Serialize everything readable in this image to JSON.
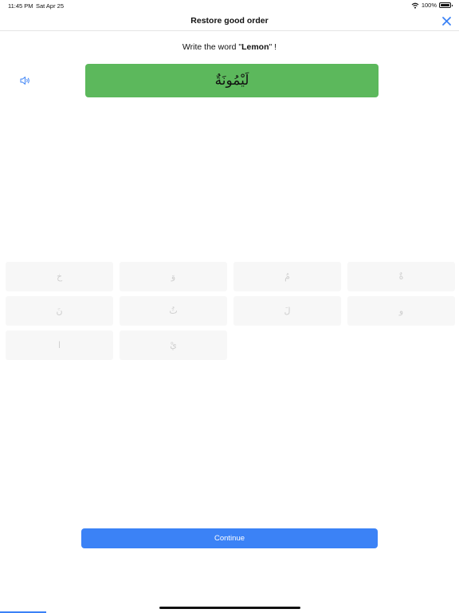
{
  "status_bar": {
    "time": "11:45 PM",
    "date": "Sat Apr 25",
    "battery_text": "100%",
    "battery_level": 1.0
  },
  "nav": {
    "title": "Restore good order",
    "close_icon": "close-icon"
  },
  "prompt": {
    "prefix": "Write the word \"",
    "word": "Lemon",
    "suffix": "\" !"
  },
  "answer": {
    "text": "لَيْمُونَةٌ",
    "color": "#5cb85c"
  },
  "letters": [
    "خ",
    "وَ",
    "مُ",
    "ةٌ",
    "نَ",
    "ثُ",
    "لَ",
    "و",
    "ا",
    "يْ"
  ],
  "continue_label": "Continue",
  "colors": {
    "accent": "#3b82f6",
    "correct": "#5cb85c",
    "tile_bg": "#f7f7f7"
  },
  "progress": 0.1
}
